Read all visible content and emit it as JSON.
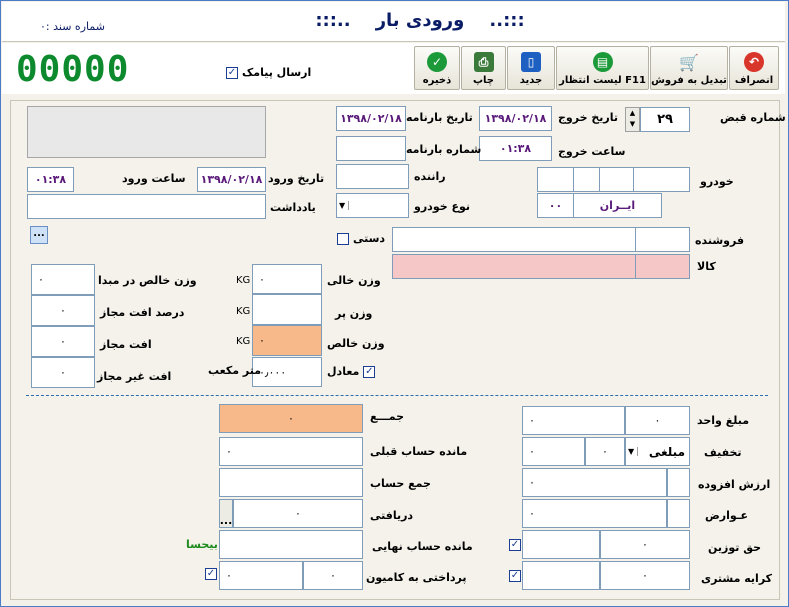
{
  "header": {
    "title": "ورودی بار",
    "title_dots_left": ":::..",
    "title_dots_right": "..:::",
    "doc_no": "شماره سند :۰"
  },
  "toolbar": {
    "counter": "00000",
    "sms_label": "ارسال پیامک",
    "sms_checked": true,
    "buttons": [
      {
        "label": "انصراف",
        "icon": "cancel-icon",
        "color": "#d9362b"
      },
      {
        "label": "تبدیل به فروش",
        "icon": "cart-icon",
        "color": "#7a7a7a"
      },
      {
        "label": "لیست انتظار F11",
        "icon": "list-icon",
        "color": "#1c9a3a"
      },
      {
        "label": "جدید",
        "icon": "new-icon",
        "color": "#1e5fc2"
      },
      {
        "label": "چاپ",
        "icon": "print-icon",
        "color": "#3a7a3a"
      },
      {
        "label": "ذخیره",
        "icon": "save-icon",
        "color": "#1c9a3a"
      }
    ]
  },
  "form": {
    "receipt_no_label": "شماره قبض",
    "receipt_no": "۲۹",
    "exit_date_label": "تاریخ خروج",
    "exit_date": "۱۳۹۸/۰۲/۱۸",
    "bill_date_label": "تاریخ بارنامه",
    "bill_date": "۱۳۹۸/۰۲/۱۸",
    "exit_time_label": "ساعت خروج",
    "exit_time": "۰۱:۳۸",
    "bill_no_label": "شماره بارنامه",
    "vehicle_label": "خودرو",
    "plate_country": "ایــران",
    "plate_code": "۰۰",
    "driver_label": "راننده",
    "entry_date_label": "تاریخ ورود",
    "entry_date": "۱۳۹۸/۰۲/۱۸",
    "entry_time_label": "ساعت ورود",
    "entry_time": "۰۱:۳۸",
    "vehicle_type_label": "نوع خودرو",
    "note_label": "یادداشت",
    "more_button": "...",
    "seller_label": "فروشنده",
    "manual_label": "دستی",
    "goods_label": "کالا",
    "empty_weight_label": "وزن خالی",
    "empty_weight": "۰",
    "full_weight_label": "وزن پر",
    "net_weight_label": "وزن خالص",
    "net_weight": "۰",
    "equivalent_label": "معادل",
    "cubic_meter_label": "متر مکعب",
    "cubic_meter": "۰٫۰۰۰",
    "kg": "KG",
    "origin_net_label": "وزن خالص در مبدا",
    "origin_net": "۰",
    "loss_percent_label": "درصد افت مجاز",
    "loss_percent": "۰",
    "allowed_loss_label": "افت مجاز",
    "allowed_loss": "۰",
    "unallowed_loss_label": "افت غیر مجاز",
    "unallowed_loss": "۰"
  },
  "totals": {
    "unit_price_label": "مبلغ واحد",
    "unit_price": "۰",
    "unit_price_2": "۰",
    "discount_label": "تخفیف",
    "discount_type": "مبلغی",
    "discount_value": "۰",
    "discount_amount": "۰",
    "vat_label": "ارزش افزوده",
    "vat": "۰",
    "duties_label": "عـوارض",
    "duties": "۰",
    "weighing_label": "حق توزین",
    "weighing": "۰",
    "customer_fare_label": "کرایه مشتری",
    "customer_fare": "۰",
    "sum_label": "جمـــع",
    "sum": "۰",
    "prev_balance_label": "مانده حساب قبلی",
    "prev_balance": "۰",
    "account_total_label": "جمع حساب",
    "received_label": "دریافتی",
    "received": "۰",
    "received_more": "...",
    "final_balance_label": "مانده حساب نهایی",
    "final_balance_status": "بیحسا",
    "truck_payment_label": "پرداختی به کامیون",
    "truck_payment": "۰",
    "truck_payment_2": "۰"
  },
  "colors": {
    "title": "#0b1c66",
    "counter": "#0e8a2e",
    "goods_highlight": "#f6c7c7",
    "orange_highlight": "#f7b98a"
  }
}
